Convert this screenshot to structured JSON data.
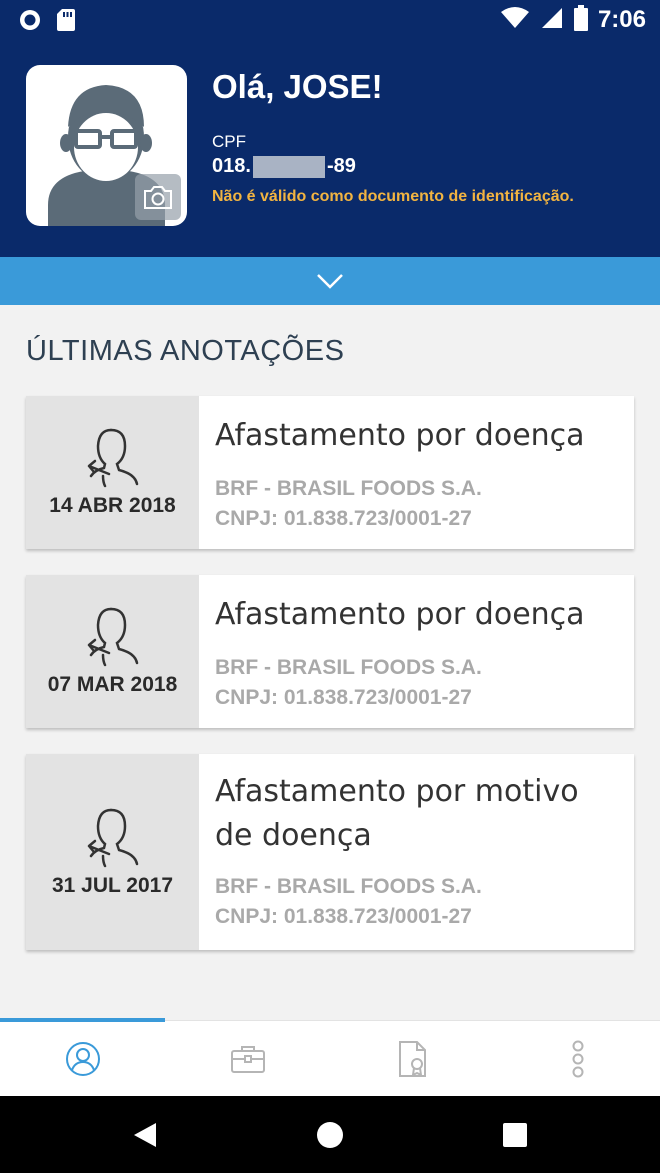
{
  "status_bar": {
    "time": "7:06",
    "icons": [
      "circle-notification-icon",
      "sd-card-icon",
      "wifi-icon",
      "signal-icon",
      "battery-icon"
    ]
  },
  "header": {
    "greeting": "Olá, JOSE!",
    "cpf_label": "CPF",
    "cpf_prefix": "018.",
    "cpf_suffix": "-89",
    "warning": "Não é válido como documento de identificação.",
    "avatar_icon": "user-avatar-glasses-icon",
    "camera_icon": "camera-icon",
    "expand_icon": "chevron-down-icon"
  },
  "section": {
    "title": "ÚLTIMAS ANOTAÇÕES"
  },
  "annotations": [
    {
      "date": "14 ABR 2018",
      "title": "Afastamento por doença",
      "company": "BRF - BRASIL FOODS S.A.",
      "cnpj": "CNPJ: 01.838.723/0001-27",
      "icon": "person-leave-icon"
    },
    {
      "date": "07 MAR 2018",
      "title": "Afastamento por doença",
      "company": "BRF - BRASIL FOODS S.A.",
      "cnpj": "CNPJ: 01.838.723/0001-27",
      "icon": "person-leave-icon"
    },
    {
      "date": "31 JUL 2017",
      "title_line1": "Afastamento por motivo",
      "title_line2": "de doença",
      "company": "BRF - BRASIL FOODS S.A.",
      "cnpj": "CNPJ: 01.838.723/0001-27",
      "icon": "person-leave-icon"
    }
  ],
  "bottom_nav": {
    "tabs": [
      "profile-icon",
      "briefcase-icon",
      "certificate-document-icon",
      "more-vertical-icon"
    ],
    "active_index": 0
  },
  "system_nav": {
    "buttons": [
      "back-icon",
      "home-icon",
      "recents-icon"
    ]
  },
  "colors": {
    "header_bg": "#0a2a6a",
    "accent_blue": "#3a9ad9",
    "warning": "#f2b441",
    "muted_text": "#a9a9a9"
  }
}
